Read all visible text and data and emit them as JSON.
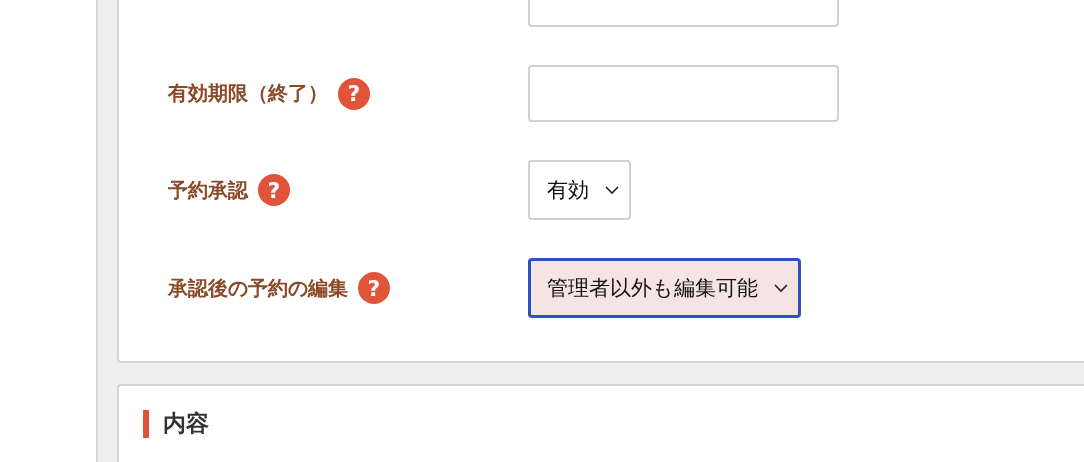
{
  "settings_card": {
    "rows": [
      {
        "kind": "input"
      },
      {
        "label": "有効期限（終了）",
        "help": "?",
        "kind": "input"
      },
      {
        "label": "予約承認",
        "help": "?",
        "kind": "select",
        "value": "有効",
        "focused": false
      },
      {
        "label": "承認後の予約の編集",
        "help": "?",
        "kind": "select",
        "value": "管理者以外も編集可能",
        "focused": true
      }
    ]
  },
  "content_card": {
    "heading": "内容"
  }
}
